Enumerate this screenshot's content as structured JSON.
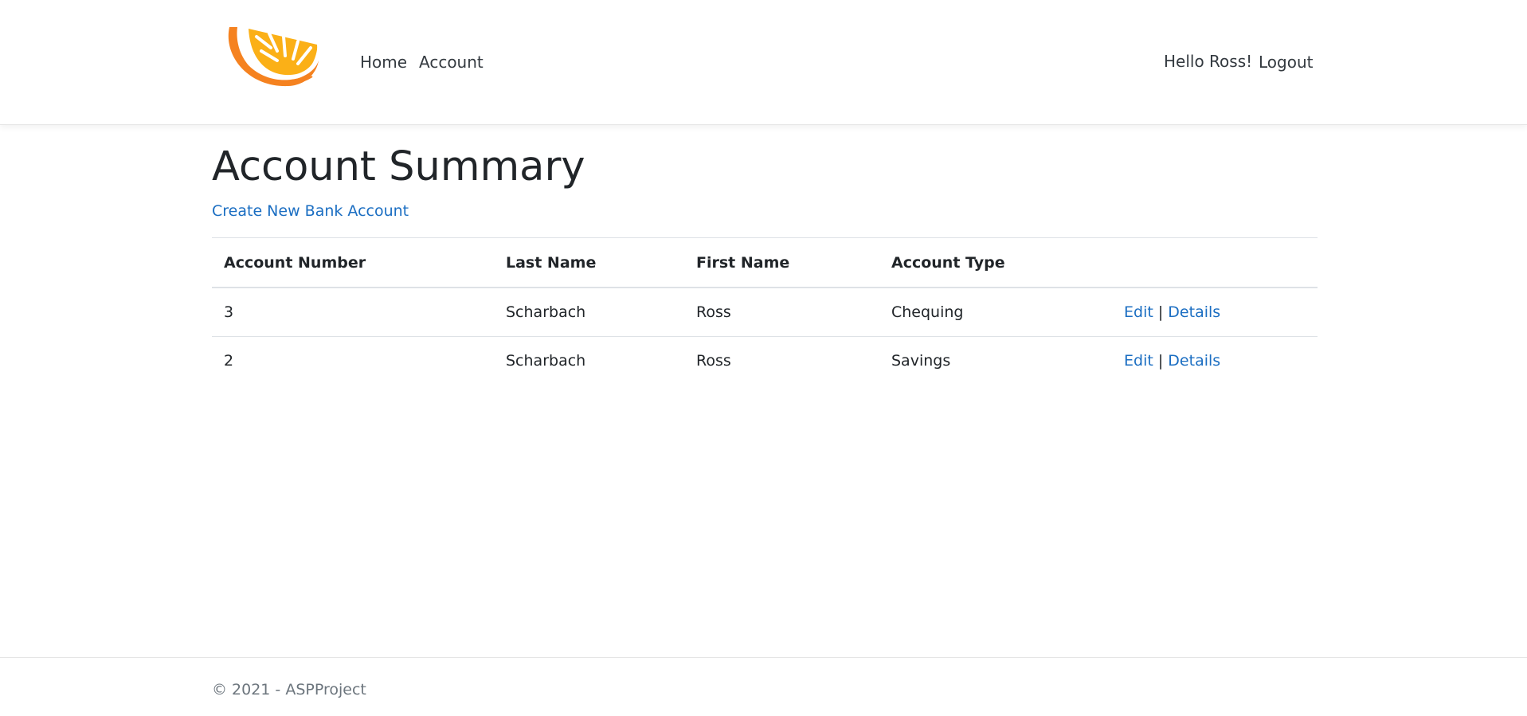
{
  "header": {
    "nav": [
      {
        "label": "Home"
      },
      {
        "label": "Account"
      }
    ],
    "greeting": "Hello Ross!",
    "logout_label": "Logout"
  },
  "main": {
    "title": "Account Summary",
    "create_link": "Create New Bank Account",
    "table": {
      "columns": [
        "Account Number",
        "Last Name",
        "First Name",
        "Account Type",
        ""
      ],
      "rows": [
        {
          "account_number": "3",
          "last_name": "Scharbach",
          "first_name": "Ross",
          "account_type": "Chequing",
          "edit": "Edit",
          "sep": "|",
          "details": "Details"
        },
        {
          "account_number": "2",
          "last_name": "Scharbach",
          "first_name": "Ross",
          "account_type": "Savings",
          "edit": "Edit",
          "sep": "|",
          "details": "Details"
        }
      ]
    }
  },
  "footer": {
    "text": "© 2021 - ASPProject"
  },
  "colors": {
    "link": "#1b6ec2",
    "text": "#212529",
    "muted": "#6c757d",
    "logo_orange": "#f58220",
    "logo_yellow": "#fbb017"
  }
}
